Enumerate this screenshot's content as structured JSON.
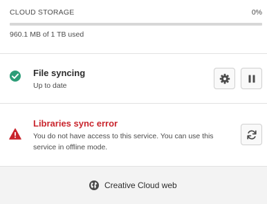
{
  "storage": {
    "title": "CLOUD STORAGE",
    "percent": "0%",
    "used": "960.1 MB of 1 TB used",
    "fill_fraction": 0.0
  },
  "file_syncing": {
    "title": "File syncing",
    "status": "Up to date",
    "icon": "check-circle-icon",
    "status_color": "#2d9d78"
  },
  "libraries": {
    "title": "Libraries sync error",
    "message": "You do not have access to this service. You can use this service in offline mode.",
    "icon": "warning-icon",
    "error_color": "#c9252d"
  },
  "footer": {
    "link_label": "Creative Cloud web",
    "icon": "globe-icon"
  }
}
